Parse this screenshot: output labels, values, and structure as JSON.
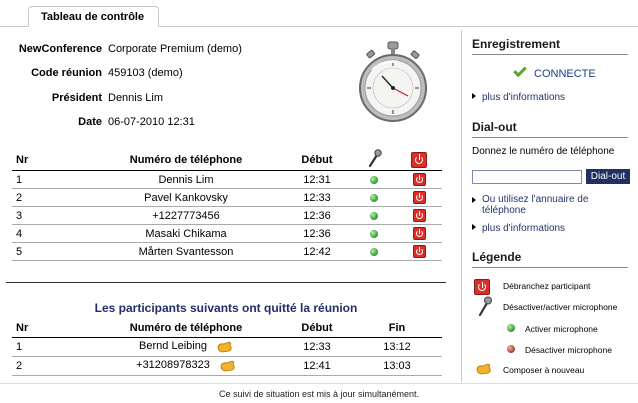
{
  "tab": {
    "label": "Tableau de contrôle"
  },
  "info": {
    "conference_label": "NewConference",
    "conference_value": "Corporate Premium (demo)",
    "code_label": "Code réunion",
    "code_value": "459103 (demo)",
    "president_label": "Président",
    "president_value": "Dennis Lim",
    "date_label": "Date",
    "date_value": "06-07-2010 12:31"
  },
  "participants": {
    "headers": {
      "nr": "Nr",
      "phone": "Numéro de téléphone",
      "start": "Début"
    },
    "rows": [
      {
        "nr": "1",
        "phone": "Dennis Lim",
        "start": "12:31"
      },
      {
        "nr": "2",
        "phone": "Pavel Kankovsky",
        "start": "12:33"
      },
      {
        "nr": "3",
        "phone": "+1227773456",
        "start": "12:36"
      },
      {
        "nr": "4",
        "phone": "Masaki Chikama",
        "start": "12:36"
      },
      {
        "nr": "5",
        "phone": "Mårten Svantesson",
        "start": "12:42"
      }
    ]
  },
  "left_meeting": {
    "title": "Les participants suivants ont quitté la réunion",
    "headers": {
      "nr": "Nr",
      "phone": "Numéro de téléphone",
      "start": "Début",
      "end": "Fin"
    },
    "rows": [
      {
        "nr": "1",
        "phone": "Bernd Leibing",
        "start": "12:33",
        "end": "13:12"
      },
      {
        "nr": "2",
        "phone": "+31208978323",
        "start": "12:41",
        "end": "13:03"
      }
    ]
  },
  "footer": "Ce suivi de situation est mis à jour simultanément.",
  "sidebar": {
    "recording": {
      "title": "Enregistrement",
      "status": "CONNECTE",
      "more_info": "plus d'informations"
    },
    "dialout": {
      "title": "Dial-out",
      "prompt": "Donnez le numéro de téléphone",
      "input_value": "",
      "button": "Dial-out",
      "directory_link": "Ou utilisez l'annuaire de téléphone",
      "more_info": "plus d'informations"
    },
    "legend": {
      "title": "Légende",
      "disconnect": "Débranchez participant",
      "toggle_mic": "Désactiver/activer microphone",
      "mic_on": "Activer microphone",
      "mic_off": "Désactiver microphone",
      "redial": "Composer à nouveau"
    }
  },
  "colors": {
    "link": "#25336b",
    "button": "#1f3061",
    "mic_on": "#3da33d",
    "disconnect": "#d9302a"
  }
}
